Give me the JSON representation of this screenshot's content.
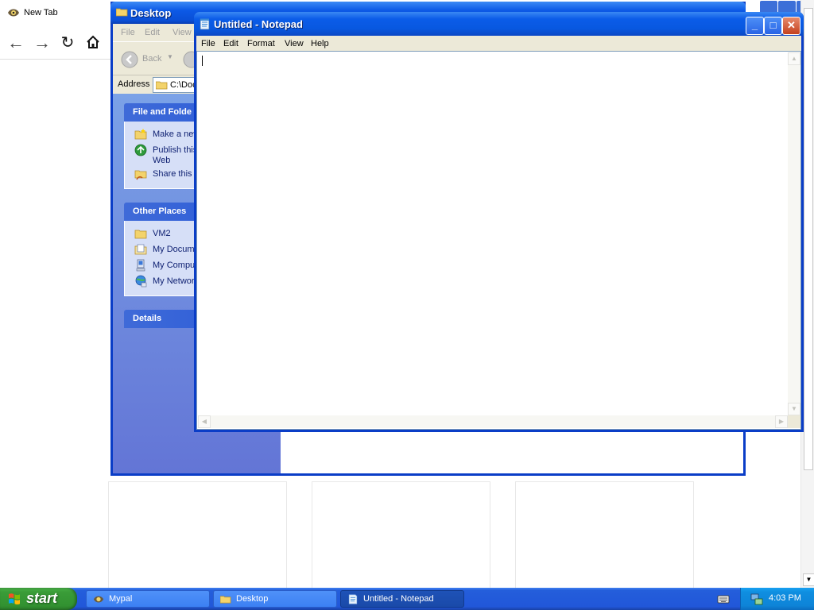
{
  "browser": {
    "tab_title": "New Tab",
    "icons": {
      "back": "back-arrow-icon",
      "forward": "forward-arrow-icon",
      "reload": "reload-icon",
      "home": "home-icon"
    }
  },
  "explorer": {
    "title": "Desktop",
    "menu": [
      "File",
      "Edit",
      "View"
    ],
    "toolbar": {
      "back_label": "Back"
    },
    "address_label": "Address",
    "address_value": "C:\\Doc",
    "file_folder_tasks": {
      "heading": "File and Folde",
      "items": [
        "Make a new",
        "Publish this",
        "Web",
        "Share this f"
      ]
    },
    "other_places": {
      "heading": "Other Places",
      "items": [
        "VM2",
        "My Docume",
        "My Comput",
        "My Networ"
      ]
    },
    "details": {
      "heading": "Details"
    }
  },
  "notepad": {
    "title": "Untitled - Notepad",
    "menu": [
      "File",
      "Edit",
      "Format",
      "View",
      "Help"
    ],
    "content": "",
    "caption_buttons": {
      "minimize": "_",
      "maximize": "□",
      "close": "✕"
    }
  },
  "taskbar": {
    "start_label": "start",
    "tasks": [
      {
        "label": "Mypal",
        "active": false
      },
      {
        "label": "Desktop",
        "active": false
      },
      {
        "label": "Untitled - Notepad",
        "active": true
      }
    ],
    "clock": "4:03 PM"
  },
  "colors": {
    "xp_title_blue": "#0b5ce8",
    "taskbar_blue": "#245edb",
    "start_green": "#3a9c38",
    "tray_blue": "#0f8ee0",
    "menu_gray": "#ece9d8"
  }
}
